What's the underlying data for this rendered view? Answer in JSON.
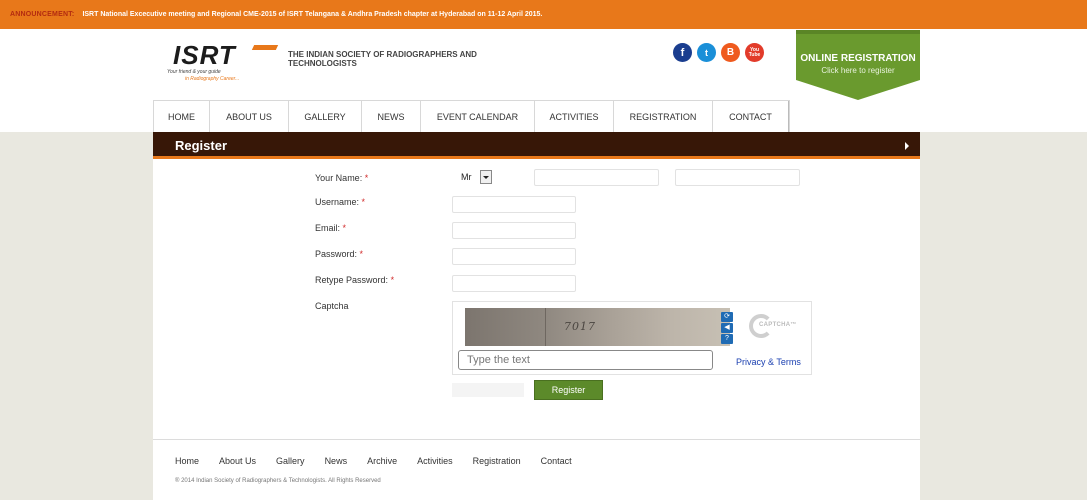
{
  "announcement": {
    "label": "ANNOUNCEMENT:",
    "text": "ISRT National Excecutive meeting and Regional CME-2015 of ISRT Telangana & Andhra Pradesh chapter at Hyderabad on 11-12 April 2015."
  },
  "header": {
    "logo_text": "ISRT",
    "logo_tagline_1": "Your friend & your guide",
    "logo_tagline_2": "in Radiography Career...",
    "society_name": "THE INDIAN SOCIETY OF RADIOGRAPHERS AND TECHNOLOGISTS",
    "social": [
      {
        "icon": "facebook-icon",
        "glyph": "f"
      },
      {
        "icon": "twitter-icon",
        "glyph": "t"
      },
      {
        "icon": "blogger-icon",
        "glyph": "B"
      },
      {
        "icon": "youtube-icon",
        "glyph": "You Tube"
      }
    ],
    "online_registration": {
      "title": "ONLINE REGISTRATION",
      "subtitle": "Click here to register",
      "color": "#6a9a2e"
    }
  },
  "nav": {
    "items": [
      "HOME",
      "ABOUT US",
      "GALLERY",
      "NEWS",
      "EVENT CALENDAR",
      "ACTIVITIES",
      "REGISTRATION",
      "CONTACT"
    ]
  },
  "page": {
    "title": "Register"
  },
  "form": {
    "name_label": "Your Name:",
    "username_label": "Username:",
    "email_label": "Email:",
    "password_label": "Password:",
    "retype_label": "Retype Password:",
    "captcha_label": "Captcha",
    "required_mark": "*",
    "title_select_value": "Mr",
    "first_name_value": "",
    "last_name_value": "",
    "username_value": "",
    "email_value": "",
    "password_value": "",
    "retype_value": "",
    "captcha": {
      "image_text": "7017",
      "input_placeholder": "Type the text",
      "privacy_link": "Privacy & Terms",
      "logo_word": "CAPTCHA™",
      "refresh_glyph": "⟳",
      "audio_glyph": "◀",
      "help_glyph": "?"
    },
    "submit_label": "Register"
  },
  "footer": {
    "links": [
      "Home",
      "About Us",
      "Gallery",
      "News",
      "Archive",
      "Activities",
      "Registration",
      "Contact"
    ],
    "copyright": "® 2014 Indian Society of Radiographers & Technologists. All Rights Reserved"
  },
  "colors": {
    "accent": "#e8781a",
    "title_bar": "#371707",
    "button_green": "#5c8a2a"
  }
}
